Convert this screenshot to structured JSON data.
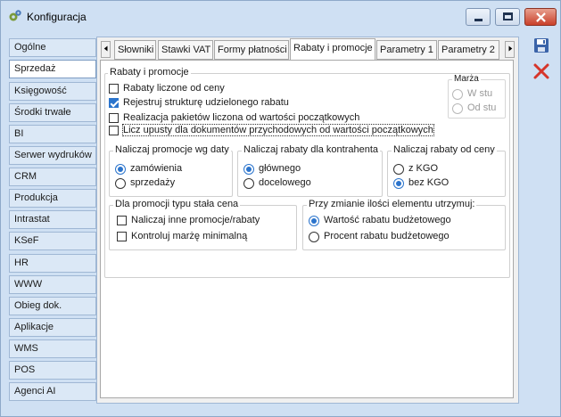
{
  "window": {
    "title": "Konfiguracja"
  },
  "sidebar": {
    "items": [
      {
        "label": "Ogólne"
      },
      {
        "label": "Sprzedaż"
      },
      {
        "label": "Księgowość"
      },
      {
        "label": "Środki trwałe"
      },
      {
        "label": "BI"
      },
      {
        "label": "Serwer wydruków"
      },
      {
        "label": "CRM"
      },
      {
        "label": "Produkcja"
      },
      {
        "label": "Intrastat"
      },
      {
        "label": "KSeF"
      },
      {
        "label": "HR"
      },
      {
        "label": "WWW"
      },
      {
        "label": "Obieg dok."
      },
      {
        "label": "Aplikacje"
      },
      {
        "label": "WMS"
      },
      {
        "label": "POS"
      },
      {
        "label": "Agenci AI"
      }
    ]
  },
  "tabs": [
    {
      "label": "Słowniki"
    },
    {
      "label": "Stawki VAT"
    },
    {
      "label": "Formy płatności"
    },
    {
      "label": "Rabaty i promocje"
    },
    {
      "label": "Parametry 1"
    },
    {
      "label": "Parametry 2"
    }
  ],
  "rabaty": {
    "group_title": "Rabaty i promocje",
    "options": [
      {
        "label": "Rabaty liczone od ceny",
        "checked": false
      },
      {
        "label": "Rejestruj strukturę udzielonego rabatu",
        "checked": true
      },
      {
        "label": "Realizacja pakietów liczona od wartości początkowych",
        "checked": false
      },
      {
        "label": "Licz upusty dla dokumentów przychodowych od wartości początkowych",
        "checked": false
      }
    ],
    "marza": {
      "title": "Marża",
      "options": [
        {
          "label": "W stu",
          "selected": false
        },
        {
          "label": "Od stu",
          "selected": true
        }
      ]
    },
    "promocje_data": {
      "title": "Naliczaj promocje wg daty",
      "options": [
        {
          "label": "zamówienia",
          "selected": true
        },
        {
          "label": "sprzedaży",
          "selected": false
        }
      ]
    },
    "kontrahent": {
      "title": "Naliczaj rabaty dla kontrahenta",
      "options": [
        {
          "label": "głównego",
          "selected": true
        },
        {
          "label": "docelowego",
          "selected": false
        }
      ]
    },
    "od_ceny": {
      "title": "Naliczaj rabaty od ceny",
      "options": [
        {
          "label": "z KGO",
          "selected": false
        },
        {
          "label": "bez KGO",
          "selected": true
        }
      ]
    },
    "stala_cena": {
      "title": "Dla promocji typu stała cena",
      "options": [
        {
          "label": "Naliczaj inne promocje/rabaty",
          "checked": false
        },
        {
          "label": "Kontroluj marżę minimalną",
          "checked": false
        }
      ]
    },
    "zmiana_ilosci": {
      "title": "Przy zmianie ilości elementu utrzymuj:",
      "options": [
        {
          "label": "Wartość rabatu budżetowego",
          "selected": true
        },
        {
          "label": "Procent rabatu budżetowego",
          "selected": false
        }
      ]
    }
  },
  "colors": {
    "accent": "#2b74cc",
    "window_bg": "#cfe0f3",
    "close": "#c9402a"
  },
  "icons": [
    "gear-app-icon",
    "save-icon",
    "cancel-icon",
    "minimize-icon",
    "maximize-icon",
    "close-icon",
    "chevron-left-icon",
    "chevron-right-icon"
  ]
}
